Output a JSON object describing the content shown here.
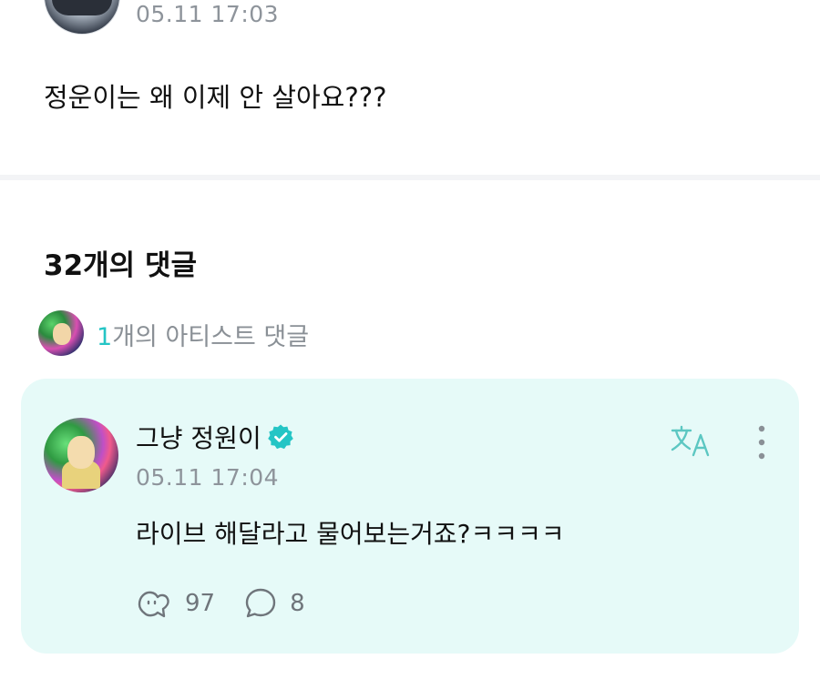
{
  "post": {
    "timestamp": "05.11 17:03",
    "body": "정운이는 왜 이제 안 살아요???"
  },
  "comments_section": {
    "heading": "32개의 댓글",
    "artist_comments": {
      "count": "1",
      "label": "개의 아티스트 댓글"
    }
  },
  "featured_comment": {
    "author": "그냥 정원이",
    "timestamp": "05.11 17:04",
    "body": "라이브 해달라고 물어보는거죠?ㅋㅋㅋㅋ",
    "likes": "97",
    "replies": "8",
    "icons": {
      "verified": "verified-badge-icon",
      "translate": "translate-icon",
      "more": "more-vertical-icon",
      "like": "like-icon",
      "reply": "comment-bubble-icon"
    }
  },
  "colors": {
    "accent": "#24c5c5",
    "card_background": "#e6faf8",
    "muted_text": "#8e949b",
    "divider": "#f3f4f6"
  }
}
